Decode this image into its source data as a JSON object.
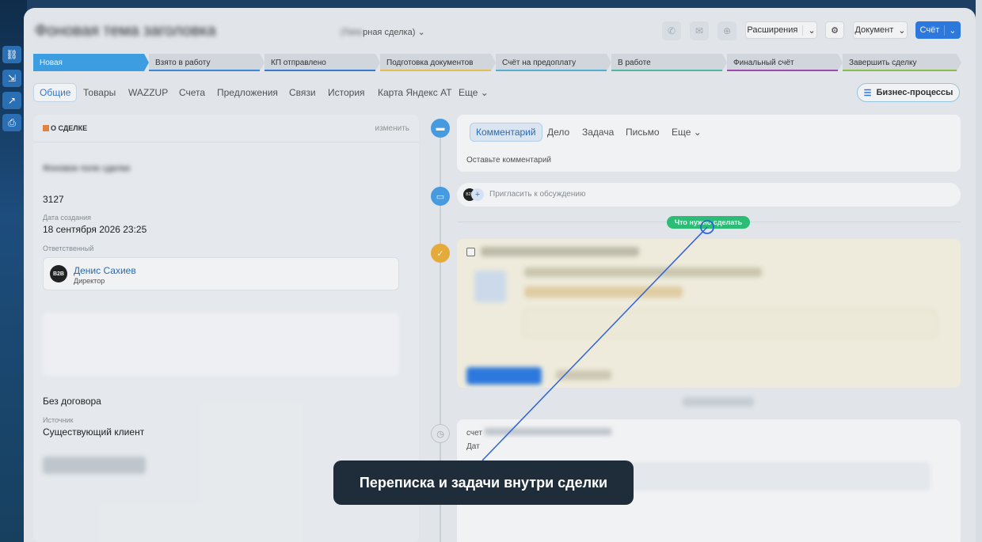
{
  "header": {
    "deal_title": "Фоновая тема заголовка",
    "deal_type_blur": "(Типо",
    "deal_type": "рная сделка)",
    "extensions_label": "Расширения",
    "document_label": "Документ",
    "invoice_label": "Счёт"
  },
  "stages": [
    {
      "label": "Новая",
      "color": "#3fa6ea",
      "active": true
    },
    {
      "label": "Взято в работу",
      "color": "#3a8fdf"
    },
    {
      "label": "КП отправлено",
      "color": "#3a7fd7"
    },
    {
      "label": "Подготовка документов",
      "color": "#f2c84b"
    },
    {
      "label": "Счёт на предоплату",
      "color": "#55b8d8"
    },
    {
      "label": "В работе",
      "color": "#54c1a8"
    },
    {
      "label": "Финальный счёт",
      "color": "#a84bb5"
    },
    {
      "label": "Завершить сделку",
      "color": "#8fc74b"
    }
  ],
  "tabs": [
    "Общие",
    "Товары",
    "WAZZUP",
    "Счета",
    "Предложения",
    "Связи",
    "История",
    "Карта Яндекс АТ",
    "Еще"
  ],
  "business_processes_label": "Бизнес-процессы",
  "about": {
    "heading": "О СДЕЛКЕ",
    "edit_label": "изменить",
    "blurred_name": "Фоновое поле сделки",
    "id_value": "3127",
    "created_label": "Дата создания",
    "created_value": "18 сентября 2026 23:25",
    "responsible_label": "Ответственный",
    "responsible_name": "Денис Сахиев",
    "responsible_role": "Директор",
    "avatar_text": "B2B",
    "contract_value": "Без договора",
    "source_label": "Источник",
    "source_value": "Существующий клиент"
  },
  "composer": {
    "tabs": [
      "Комментарий",
      "Дело",
      "Задача",
      "Письмо",
      "Еще"
    ],
    "placeholder": "Оставьте комментарий"
  },
  "invite_text": "Пригласить к обсуждению",
  "todo_label": "Что нужно сделать",
  "bottom_card": {
    "title": "счет",
    "date_label": "Дат"
  },
  "callout_text": "Переписка и задачи внутри сделки",
  "colors": {
    "accent": "#2f7ee6",
    "todo_green": "#2fc679",
    "callout_bg": "#1f2d3a",
    "task_bg": "#fcf8e6"
  }
}
